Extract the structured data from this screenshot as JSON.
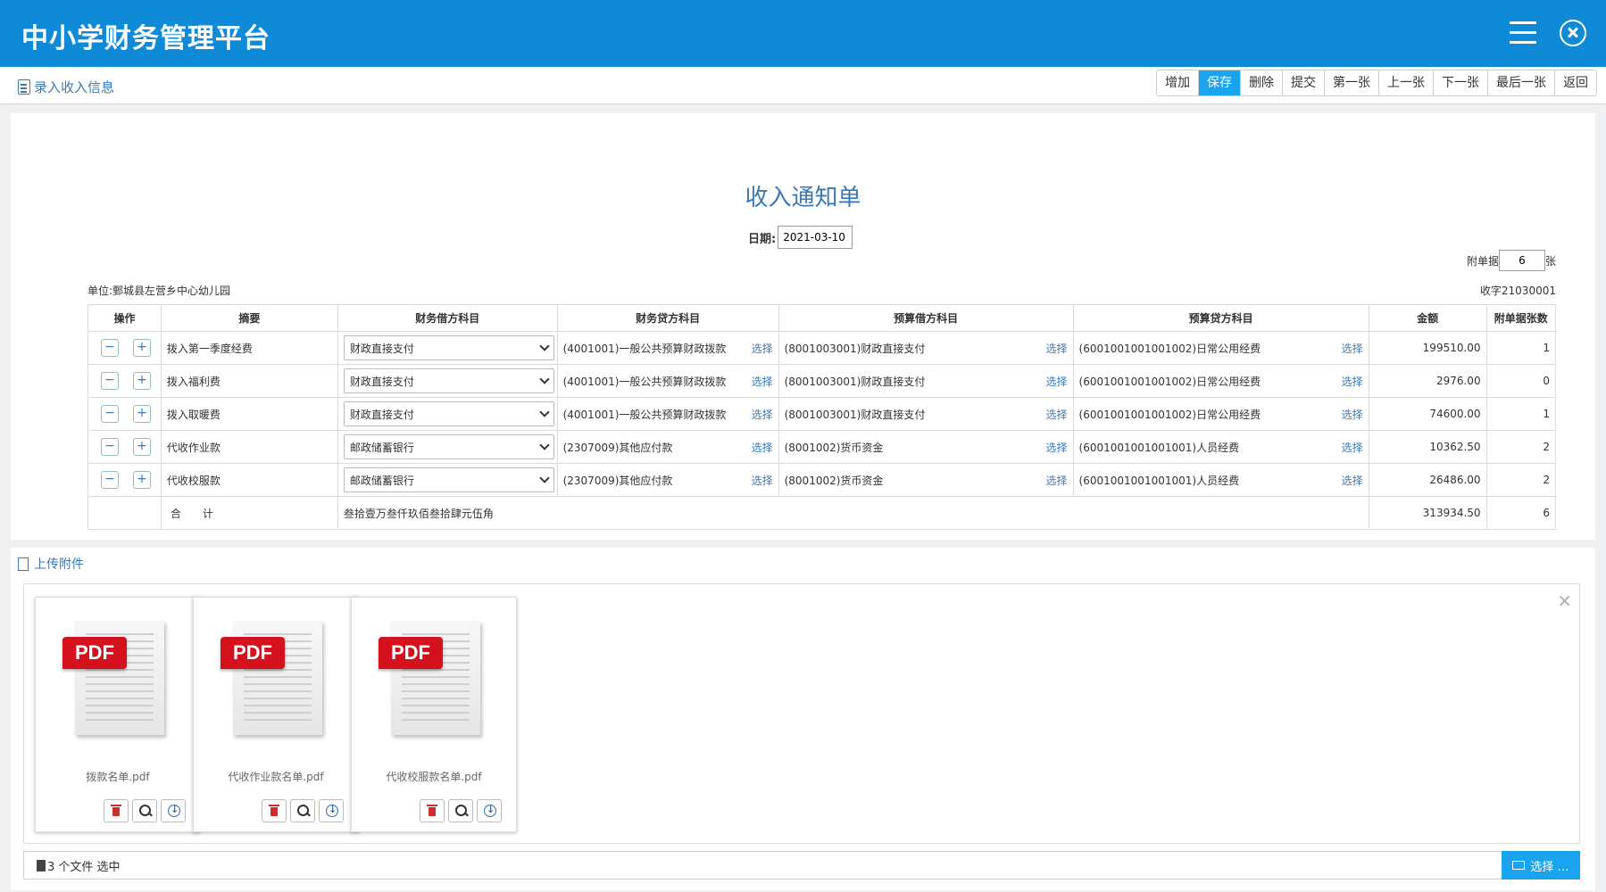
{
  "app": {
    "title": "中小学财务管理平台"
  },
  "breadcrumb": {
    "label": "录入收入信息"
  },
  "toolbar": {
    "buttons": [
      {
        "label": "增加",
        "active": false
      },
      {
        "label": "保存",
        "active": true
      },
      {
        "label": "删除",
        "active": false
      },
      {
        "label": "提交",
        "active": false
      },
      {
        "label": "第一张",
        "active": false
      },
      {
        "label": "上一张",
        "active": false
      },
      {
        "label": "下一张",
        "active": false
      },
      {
        "label": "最后一张",
        "active": false
      },
      {
        "label": "返回",
        "active": false
      }
    ]
  },
  "form": {
    "title": "收入通知单",
    "date_label": "日期:",
    "date_value": "2021-03-10",
    "attach_label": "附单据",
    "attach_count": "6",
    "attach_unit": "张",
    "unit": "单位:鄄城县左营乡中心幼儿园",
    "doc_no": "收字21030001",
    "headers": [
      "操作",
      "摘要",
      "财务借方科目",
      "财务贷方科目",
      "预算借方科目",
      "预算贷方科目",
      "金额",
      "附单据张数"
    ],
    "pick_label": "选择",
    "rows": [
      {
        "summary": "拨入第一季度经费",
        "debit": "财政直接支付",
        "credit": "(4001001)一般公共预算财政拨款",
        "budget_debit": "(8001003001)财政直接支付",
        "budget_credit": "(6001001001001002)日常公用经费",
        "amount": "199510.00",
        "attachments": "1"
      },
      {
        "summary": "拨入福利费",
        "debit": "财政直接支付",
        "credit": "(4001001)一般公共预算财政拨款",
        "budget_debit": "(8001003001)财政直接支付",
        "budget_credit": "(6001001001001002)日常公用经费",
        "amount": "2976.00",
        "attachments": "0"
      },
      {
        "summary": "拨入取暖费",
        "debit": "财政直接支付",
        "credit": "(4001001)一般公共预算财政拨款",
        "budget_debit": "(8001003001)财政直接支付",
        "budget_credit": "(6001001001001002)日常公用经费",
        "amount": "74600.00",
        "attachments": "1"
      },
      {
        "summary": "代收作业款",
        "debit": "邮政储蓄银行",
        "credit": "(2307009)其他应付款",
        "budget_debit": "(8001002)货币资金",
        "budget_credit": "(6001001001001001)人员经费",
        "amount": "10362.50",
        "attachments": "2"
      },
      {
        "summary": "代收校服款",
        "debit": "邮政储蓄银行",
        "credit": "(2307009)其他应付款",
        "budget_debit": "(8001002)货币资金",
        "budget_credit": "(6001001001001001)人员经费",
        "amount": "26486.00",
        "attachments": "2"
      }
    ],
    "total": {
      "label": "合　　计",
      "amount_words": "叁拾壹万叁仟玖佰叁拾肆元伍角",
      "amount": "313934.50",
      "attachments": "6"
    }
  },
  "upload": {
    "title": "上传附件",
    "files": [
      {
        "name": "拨款名单.pdf",
        "badge": "PDF"
      },
      {
        "name": "代收作业款名单.pdf",
        "badge": "PDF"
      },
      {
        "name": "代收校服款名单.pdf",
        "badge": "PDF"
      }
    ],
    "status": "3 个文件 选中",
    "pick_button": "选择 …"
  }
}
